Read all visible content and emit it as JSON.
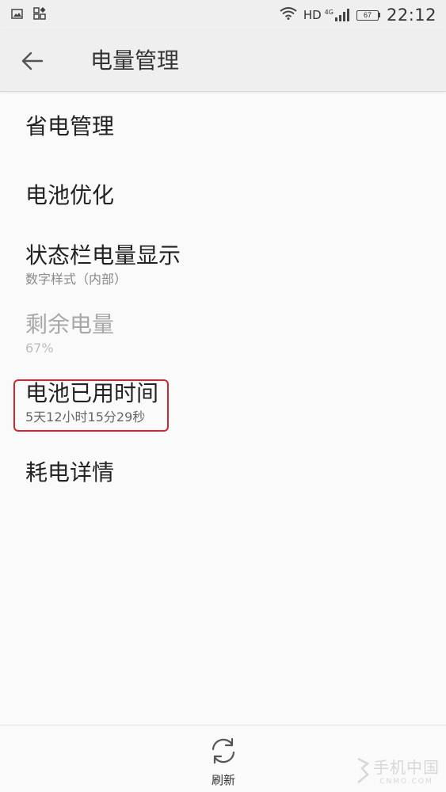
{
  "status_bar": {
    "network": "HD",
    "signal_gen": "4G",
    "battery_level": "67",
    "time": "22:12"
  },
  "header": {
    "title": "电量管理"
  },
  "settings": [
    {
      "title": "省电管理",
      "subtitle": null,
      "enabled": true
    },
    {
      "title": "电池优化",
      "subtitle": null,
      "enabled": true
    },
    {
      "title": "状态栏电量显示",
      "subtitle": "数字样式（内部）",
      "enabled": true
    },
    {
      "title": "剩余电量",
      "subtitle": "67%",
      "enabled": false
    },
    {
      "title": "电池已用时间",
      "subtitle": "5天12小时15分29秒",
      "enabled": true
    },
    {
      "title": "耗电详情",
      "subtitle": null,
      "enabled": true
    }
  ],
  "bottom": {
    "refresh_label": "刷新"
  },
  "watermark": {
    "cn": "手机中国",
    "en": "CNMO.COM"
  },
  "colors": {
    "highlight": "#d8252c",
    "bar_bg": "#efefef",
    "page_bg": "#fafafa"
  }
}
